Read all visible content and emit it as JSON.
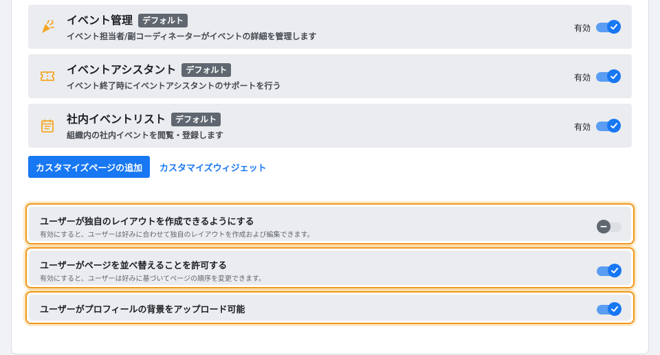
{
  "apps": [
    {
      "title": "イベント管理",
      "badge": "デフォルト",
      "description": "イベント担当者/副コーディネーターがイベントの詳細を管理します",
      "status": "有効",
      "icon": "party-popper-icon",
      "enabled": true
    },
    {
      "title": "イベントアシスタント",
      "badge": "デフォルト",
      "description": "イベント終了時にイベントアシスタントのサポートを行う",
      "status": "有効",
      "icon": "ticket-icon",
      "enabled": true
    },
    {
      "title": "社内イベントリスト",
      "badge": "デフォルト",
      "description": "組織内の社内イベントを閲覧・登録します",
      "status": "有効",
      "icon": "calendar-list-icon",
      "enabled": true
    }
  ],
  "actions": {
    "add_page": "カスタマイズページの追加",
    "customize_widget": "カスタマイズウィジェット"
  },
  "settings": [
    {
      "title": "ユーザーが独自のレイアウトを作成できるようにする",
      "description": "有効にすると、ユーザーは好みに合わせて独自のレイアウトを作成および編集できます。",
      "enabled": false
    },
    {
      "title": "ユーザーがページを並べ替えることを許可する",
      "description": "有効にすると、ユーザーは好みに基づいてページの順序を変更できます。",
      "enabled": true
    },
    {
      "title": "ユーザーがプロフィールの背景をアップロード可能",
      "enabled": true
    }
  ],
  "colors": {
    "accent": "#1877f2",
    "app_icon": "#f5a623",
    "highlight_border": "#f0961a"
  }
}
